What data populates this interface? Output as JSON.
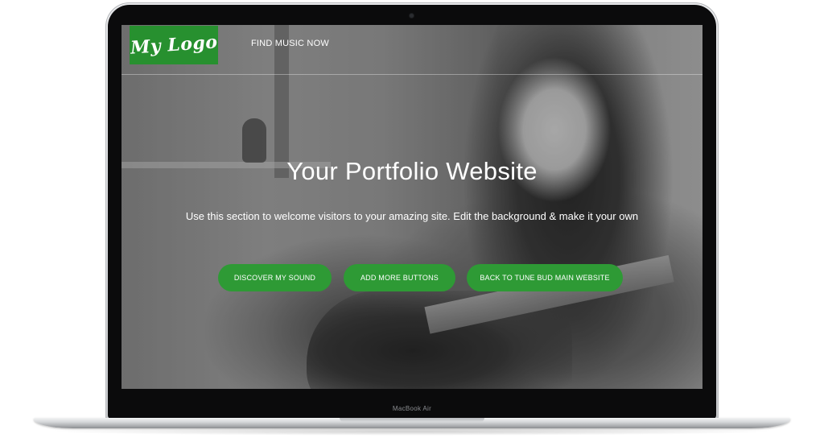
{
  "device": {
    "model_label": "MacBook Air"
  },
  "header": {
    "logo_text": "My Logo",
    "nav_link": "FIND MUSIC NOW"
  },
  "hero": {
    "title": "Your Portfolio Website",
    "subtitle": "Use this section to welcome visitors to your amazing site. Edit the background & make it your own",
    "buttons": [
      {
        "label": "DISCOVER MY SOUND"
      },
      {
        "label": "ADD MORE BUTTONS"
      },
      {
        "label": "BACK TO TUNE BUD MAIN WEBSITE"
      }
    ]
  },
  "colors": {
    "accent_green": "#2e9a35",
    "logo_green": "#27902f",
    "text": "#ffffff"
  }
}
